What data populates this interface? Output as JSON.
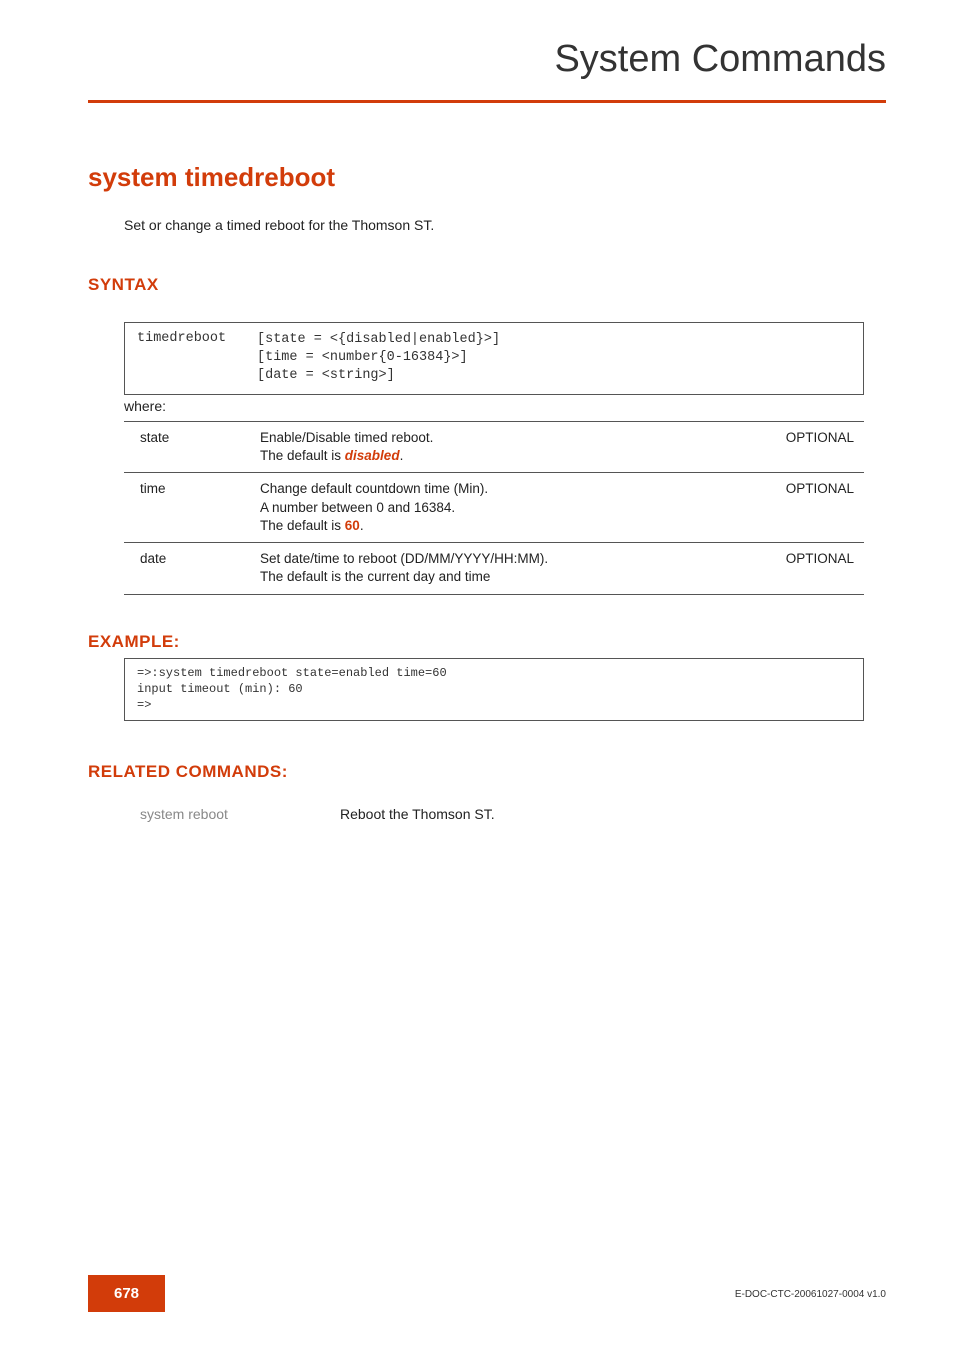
{
  "header": {
    "title": "System Commands"
  },
  "command": {
    "title": "system timedreboot",
    "description": "Set or change a timed reboot for the Thomson ST."
  },
  "syntax": {
    "section_label": "SYNTAX",
    "command": "timedreboot",
    "args_line1": "[state = <{disabled|enabled}>]",
    "args_line2": "[time = <number{0-16384}>]",
    "args_line3": "[date = <string>]"
  },
  "where_label": "where:",
  "params": [
    {
      "name": "state",
      "desc_line1": "Enable/Disable timed reboot.",
      "desc_prefix": "The default is ",
      "default_value": "disabled",
      "desc_suffix": ".",
      "flag": "OPTIONAL"
    },
    {
      "name": "time",
      "desc_line1": "Change default countdown time (Min).",
      "desc_line2": "A number between 0 and 16384.",
      "desc_prefix": "The default is ",
      "default_value": "60",
      "desc_suffix": ".",
      "flag": "OPTIONAL"
    },
    {
      "name": "date",
      "desc_line1": "Set date/time to reboot (DD/MM/YYYY/HH:MM).",
      "desc_line2": "The default is the current day and time",
      "flag": "OPTIONAL"
    }
  ],
  "example": {
    "section_label": "EXAMPLE:",
    "line1": "=>:system timedreboot state=enabled time=60",
    "line2": "input timeout (min): 60",
    "line3": "=>"
  },
  "related": {
    "section_label": "RELATED COMMANDS:",
    "cmd": "system reboot",
    "desc": "Reboot the Thomson ST."
  },
  "footer": {
    "page_number": "678",
    "doc_id": "E-DOC-CTC-20061027-0004 v1.0"
  }
}
